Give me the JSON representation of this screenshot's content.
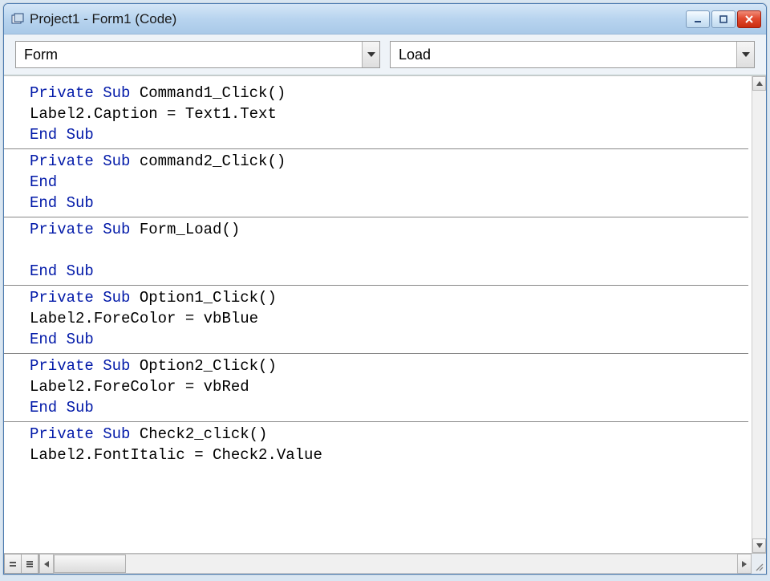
{
  "window": {
    "title": "Project1 - Form1 (Code)"
  },
  "dropdowns": {
    "object": "Form",
    "procedure": "Load"
  },
  "code": {
    "blocks": [
      {
        "lines": [
          {
            "segments": [
              {
                "t": "Private Sub",
                "kw": true
              },
              {
                "t": " Command1_Click()",
                "kw": false
              }
            ]
          },
          {
            "segments": [
              {
                "t": "Label2.Caption = Text1.Text",
                "kw": false
              }
            ]
          },
          {
            "segments": [
              {
                "t": "End Sub",
                "kw": true
              }
            ]
          }
        ]
      },
      {
        "lines": [
          {
            "segments": [
              {
                "t": "Private Sub",
                "kw": true
              },
              {
                "t": " command2_Click()",
                "kw": false
              }
            ]
          },
          {
            "segments": [
              {
                "t": "End",
                "kw": true
              }
            ]
          },
          {
            "segments": [
              {
                "t": "End Sub",
                "kw": true
              }
            ]
          }
        ]
      },
      {
        "lines": [
          {
            "segments": [
              {
                "t": "Private Sub",
                "kw": true
              },
              {
                "t": " Form_Load()",
                "kw": false
              }
            ]
          },
          {
            "segments": [
              {
                "t": " ",
                "kw": false
              }
            ]
          },
          {
            "segments": [
              {
                "t": "End Sub",
                "kw": true
              }
            ]
          }
        ]
      },
      {
        "lines": [
          {
            "segments": [
              {
                "t": "Private Sub",
                "kw": true
              },
              {
                "t": " Option1_Click()",
                "kw": false
              }
            ]
          },
          {
            "segments": [
              {
                "t": "Label2.ForeColor = vbBlue",
                "kw": false
              }
            ]
          },
          {
            "segments": [
              {
                "t": "End Sub",
                "kw": true
              }
            ]
          }
        ]
      },
      {
        "lines": [
          {
            "segments": [
              {
                "t": "Private Sub",
                "kw": true
              },
              {
                "t": " Option2_Click()",
                "kw": false
              }
            ]
          },
          {
            "segments": [
              {
                "t": "Label2.ForeColor = vbRed",
                "kw": false
              }
            ]
          },
          {
            "segments": [
              {
                "t": "End Sub",
                "kw": true
              }
            ]
          }
        ]
      },
      {
        "lines": [
          {
            "segments": [
              {
                "t": "Private Sub",
                "kw": true
              },
              {
                "t": " Check2_click()",
                "kw": false
              }
            ]
          },
          {
            "segments": [
              {
                "t": "Label2.FontItalic = Check2.Value",
                "kw": false
              }
            ]
          }
        ]
      }
    ]
  }
}
